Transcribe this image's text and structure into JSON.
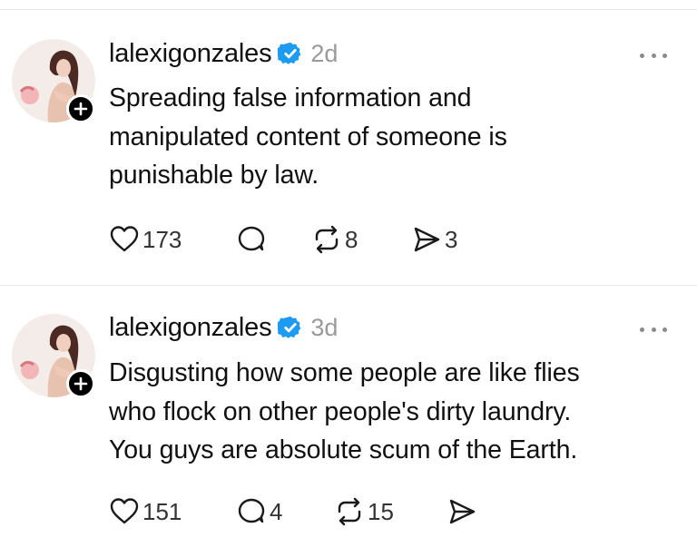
{
  "posts": [
    {
      "username": "lalexigonzales",
      "time": "2d",
      "text": "Spreading false information and\nmanipulated content of someone is\npunishable by law.",
      "likes": "173",
      "replies": "",
      "reposts": "8",
      "shares": "3"
    },
    {
      "username": "lalexigonzales",
      "time": "3d",
      "text": "Disgusting how some people are like flies\nwho flock on other people's dirty laundry.\nYou guys are absolute scum of the Earth.",
      "likes": "151",
      "replies": "4",
      "reposts": "15",
      "shares": ""
    }
  ],
  "icons": {
    "like": "heart-icon",
    "reply": "comment-bubble-icon",
    "repost": "repost-arrows-icon",
    "share": "send-arrow-icon",
    "verified": "verified-badge-icon",
    "more": "more-dots-icon",
    "follow": "plus-icon"
  },
  "colors": {
    "verified": "#1d9bf0",
    "text": "#101010",
    "muted": "#9a9a9a"
  }
}
